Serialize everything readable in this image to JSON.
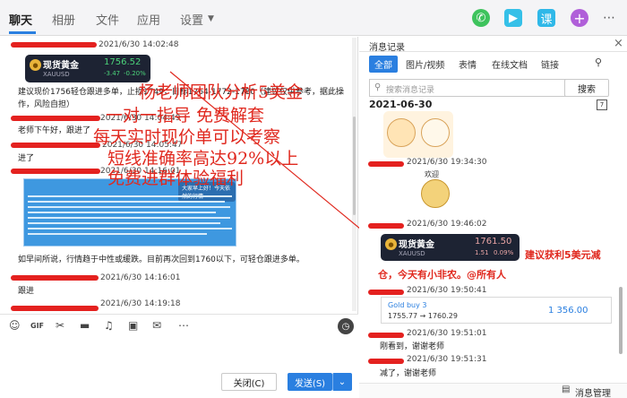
{
  "topbar": {
    "tabs": [
      "聊天",
      "相册",
      "文件",
      "应用",
      "设置"
    ],
    "icons": [
      {
        "name": "phone-icon",
        "color": "#3ec35d",
        "glyph": "✆"
      },
      {
        "name": "video-icon",
        "color": "#35c0e8",
        "glyph": "▶"
      },
      {
        "name": "class-icon",
        "color": "#2fb8e8",
        "glyph": "课"
      },
      {
        "name": "add-icon",
        "color": "#b05fd9",
        "glyph": "+"
      },
      {
        "name": "more-icon",
        "color": "#555555",
        "glyph": "⋯"
      }
    ]
  },
  "chat": {
    "messages": [
      {
        "ts": "2021/6/30 14:02:48"
      },
      {
        "ticker_name": "现货黄金",
        "ticker_price": "1756.52",
        "ticker_change": "-3.47",
        "ticker_pct": "-0.20%",
        "ticker_code": "XAUUSD"
      },
      {
        "text": "建议现价1756轻仓跟进多单，止损1749，目标1764-1772-1780（建议仅供参考，据此操作，风险自担）"
      },
      {
        "ts": "2021/6/30 14:04:49"
      },
      {
        "text": "老师下午好，跟进了"
      },
      {
        "ts": "2021/6/30 14:05:47"
      },
      {
        "text": "进了"
      },
      {
        "ts": "2021/6/30 14:16:01"
      },
      {
        "screenshot_header": "大家早上好！今天依然的行情"
      },
      {
        "text": "如早间所说，行情趋于中性或缓跌。目前再次回到1760以下，可轻仓跟进多单。"
      },
      {
        "ts": "2021/6/30 14:16:01"
      },
      {
        "text": "跟进"
      },
      {
        "ts": "2021/6/30 14:19:18"
      }
    ],
    "overlay": [
      "杨老师团队分析5美金",
      "一对一指导    免费解套",
      "每天实时现价单可以考察",
      "短线准确率高达92%以上",
      "免费进群体验福利"
    ]
  },
  "input": {
    "icons": [
      "emoji-icon",
      "gif-icon",
      "scissors-icon",
      "folder-icon",
      "music-icon",
      "image-icon",
      "red-packet-icon",
      "more-dots-icon",
      "history-clock-icon"
    ],
    "close_label": "关闭(C)",
    "send_label": "发送(S)",
    "send_caret": "⌄"
  },
  "history": {
    "title": "消息记录",
    "close_glyph": "×",
    "tabs": [
      "全部",
      "图片/视频",
      "表情",
      "在线文档",
      "链接"
    ],
    "search_placeholder": "搜索消息记录",
    "search_button": "搜索",
    "calendar_glyph": "7",
    "date": "2021-06-30",
    "items": [
      {
        "ts": "2021/6/30 19:34:30"
      },
      {
        "sticker_caption": "欢迎"
      },
      {
        "ts": "2021/6/30 19:46:02"
      },
      {
        "ticker_name": "现货黄金",
        "ticker_price": "1761.50",
        "ticker_change": "1.51",
        "ticker_pct": "0.09%",
        "ticker_code": "XAUUSD"
      },
      {
        "advice": "建议获利5美元减仓，今天有小非农。@所有人"
      },
      {
        "ts": "2021/6/30 19:50:41"
      },
      {
        "trade_title": "Gold buy 3",
        "trade_range": "1755.77 → 1760.29",
        "trade_profit": "1 356.00"
      },
      {
        "ts": "2021/6/30 19:51:01"
      },
      {
        "text": "刚看到，谢谢老师"
      },
      {
        "ts": "2021/6/30 19:51:31"
      },
      {
        "text": "减了，谢谢老师"
      }
    ],
    "manage_label": "消息管理"
  }
}
